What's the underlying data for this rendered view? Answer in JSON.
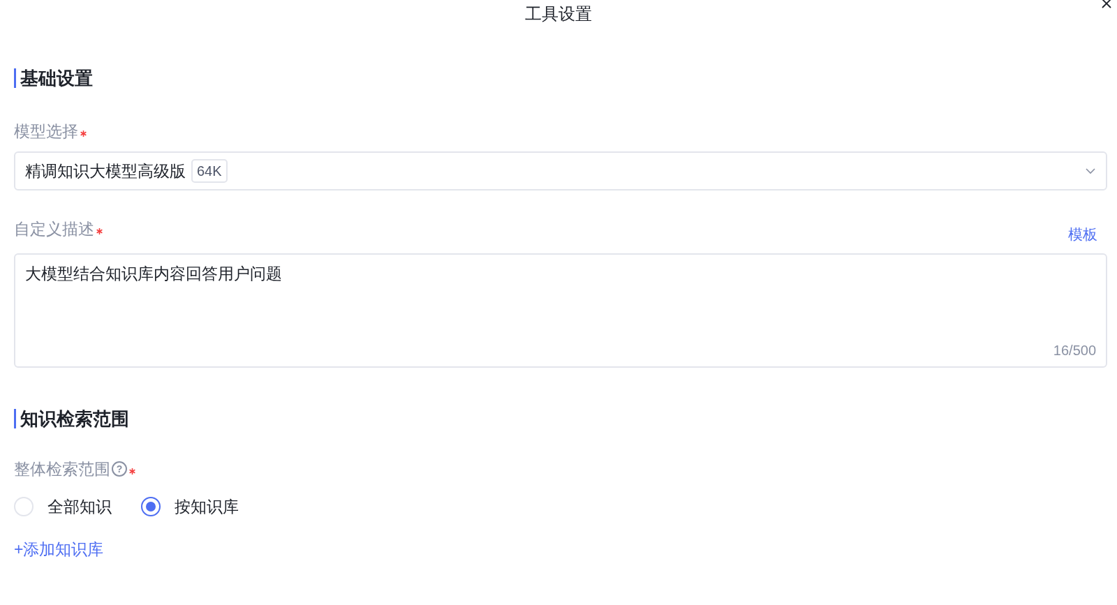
{
  "dialog": {
    "title": "工具设置"
  },
  "sections": [
    {
      "title": "基础设置"
    },
    {
      "title": "知识检索范围"
    }
  ],
  "model": {
    "label": "模型选择",
    "required": true,
    "value": "精调知识大模型高级版",
    "tag": "64K"
  },
  "description": {
    "label": "自定义描述",
    "required": true,
    "link": "模板",
    "value": "大模型结合知识库内容回答用户问题",
    "counter": "16/500"
  },
  "scope": {
    "label": "整体检索范围",
    "required": true,
    "help": "?",
    "options": [
      {
        "label": "全部知识",
        "selected": false
      },
      {
        "label": "按知识库",
        "selected": true
      }
    ],
    "add_link": "+添加知识库"
  }
}
